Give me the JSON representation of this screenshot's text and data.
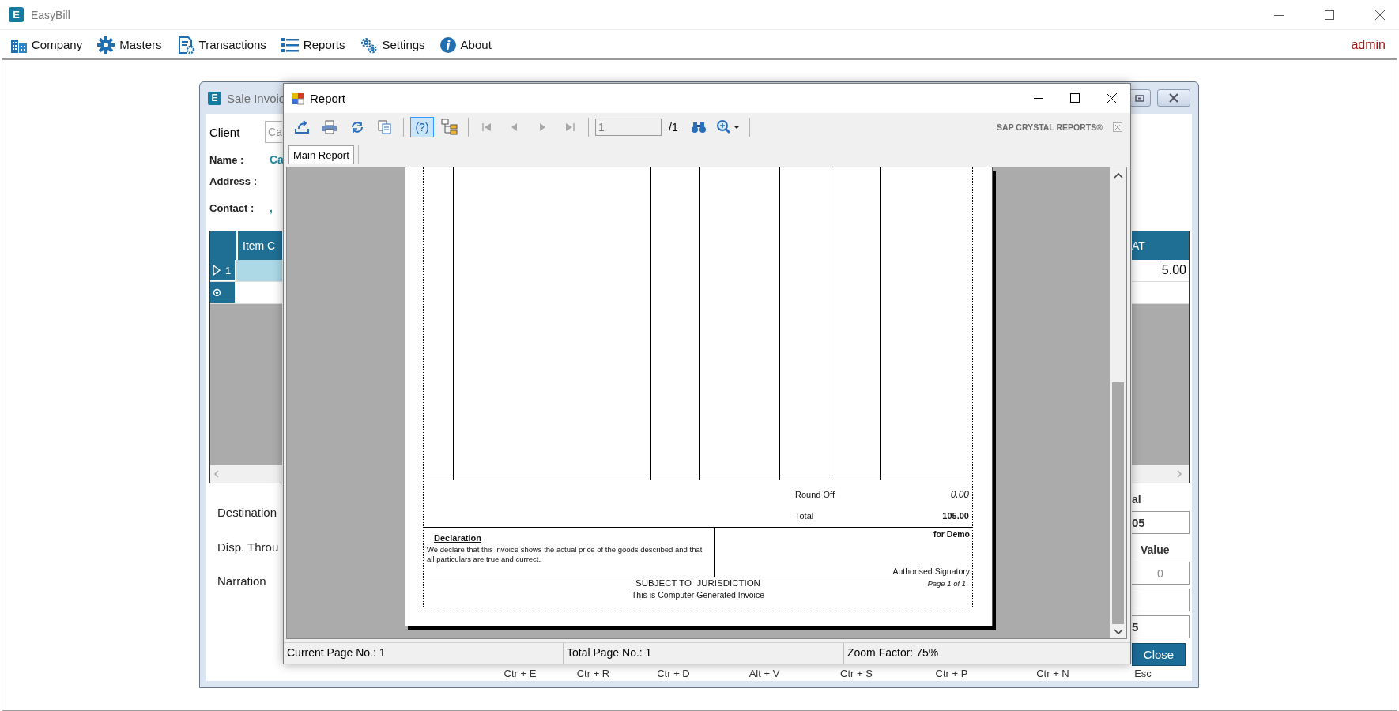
{
  "app": {
    "logo": "E",
    "title": "EasyBill",
    "user": "admin"
  },
  "menu": [
    {
      "label": "Company"
    },
    {
      "label": "Masters"
    },
    {
      "label": "Transactions"
    },
    {
      "label": "Reports"
    },
    {
      "label": "Settings"
    },
    {
      "label": "About"
    }
  ],
  "sale_invoice": {
    "logo": "E",
    "title": "Sale Invoic",
    "client_label": "Client",
    "client_value": "Ca",
    "fields": [
      {
        "label": "Name :",
        "value": "Ca"
      },
      {
        "label": "Address :"
      },
      {
        "label": "Contact :",
        "value": ","
      }
    ],
    "grid": {
      "columns": [
        "Item C",
        "AT"
      ],
      "rows": [
        {
          "kind": "current",
          "number": "1",
          "selected": true,
          "value": "5.00"
        },
        {
          "kind": "new",
          "selected": false
        }
      ]
    },
    "left_labels": [
      "Destination",
      "Disp. Throu",
      "Narration"
    ],
    "right_fields": [
      {
        "kind": "total",
        "label": "al",
        "value": "05"
      },
      {
        "kind": "number",
        "label": "Value",
        "value": "0"
      },
      {
        "kind": "blank"
      },
      {
        "kind": "total",
        "value": "5"
      }
    ],
    "close_button": "Close",
    "shortcuts": [
      "Ctr + E",
      "Ctr + R",
      "Ctr + D",
      "Alt + V",
      "Ctr + S",
      "Ctr + P",
      "Ctr + N",
      "Esc"
    ]
  },
  "report": {
    "title": "Report",
    "toolbar": {
      "help_label": "(?)",
      "help_on": true,
      "navigation_disabled": true,
      "page": "1",
      "page_total": "/1",
      "brand": "SAP CRYSTAL REPORTS®"
    },
    "tabs": [
      {
        "label": "Main Report",
        "selected": true
      }
    ],
    "invoice": {
      "round_off_label": "Round Off",
      "round_off": "0.00",
      "total_label": "Total",
      "total": "105.00",
      "declaration_title": "Declaration",
      "declaration_text": "We declare that this invoice shows the actual price of the goods described and that all particulars are true and currect.",
      "for": "for Demo",
      "signatory": "Authorised Signatory",
      "jurisdiction": "SUBJECT TO  JURISDICTION",
      "generated": "This is Computer Generated Invoice",
      "page": "Page 1 of 1"
    },
    "status_bar": [
      "Current Page No.: 1",
      "Total Page No.: 1",
      "Zoom Factor: 75%"
    ]
  }
}
